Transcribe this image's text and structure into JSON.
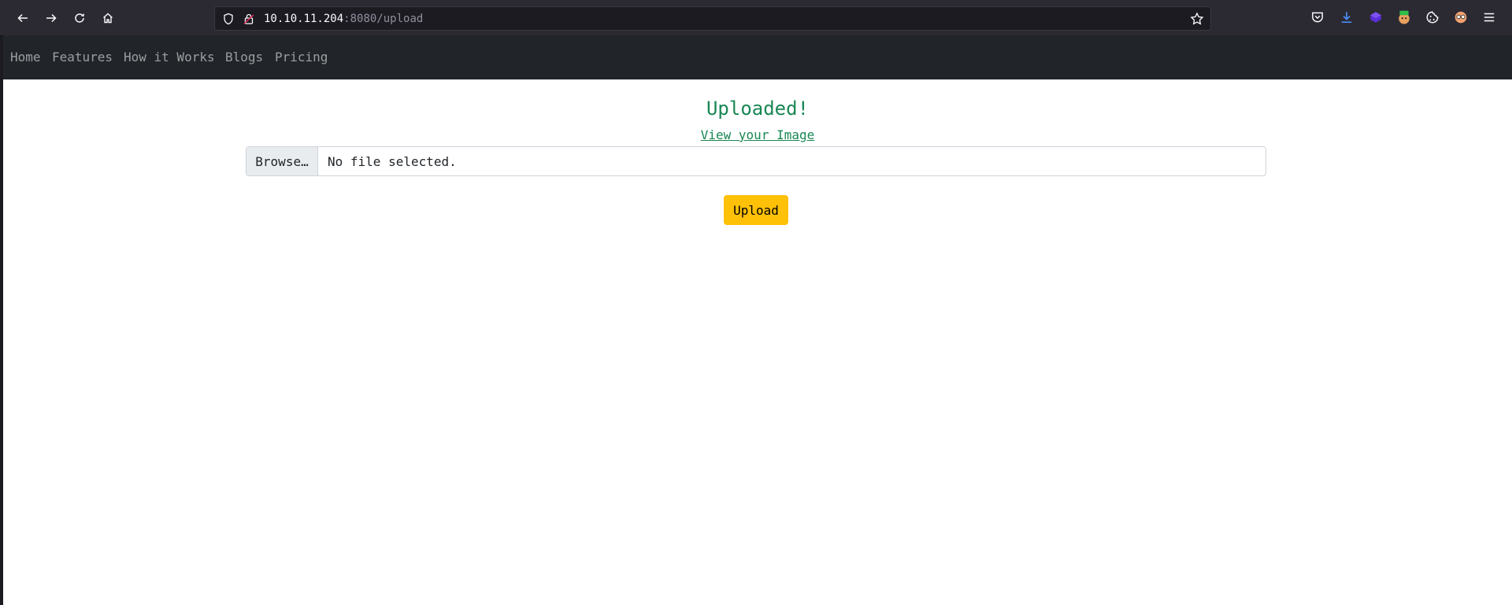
{
  "browser": {
    "url_host": "10.10.11.204",
    "url_rest": ":8080/upload",
    "accent_colors": {
      "download": "#4b8df8",
      "extension_purple": "#5b2fd6"
    }
  },
  "navbar": {
    "links": [
      "Home",
      "Features",
      "How it Works",
      "Blogs",
      "Pricing"
    ]
  },
  "main": {
    "status_title": "Uploaded!",
    "view_link": "View your Image",
    "file_input": {
      "browse_label": "Browse…",
      "status_text": "No file selected."
    },
    "upload_button": "Upload"
  },
  "colors": {
    "success": "#198754",
    "warning": "#ffc107",
    "navbar_bg": "#212529"
  }
}
